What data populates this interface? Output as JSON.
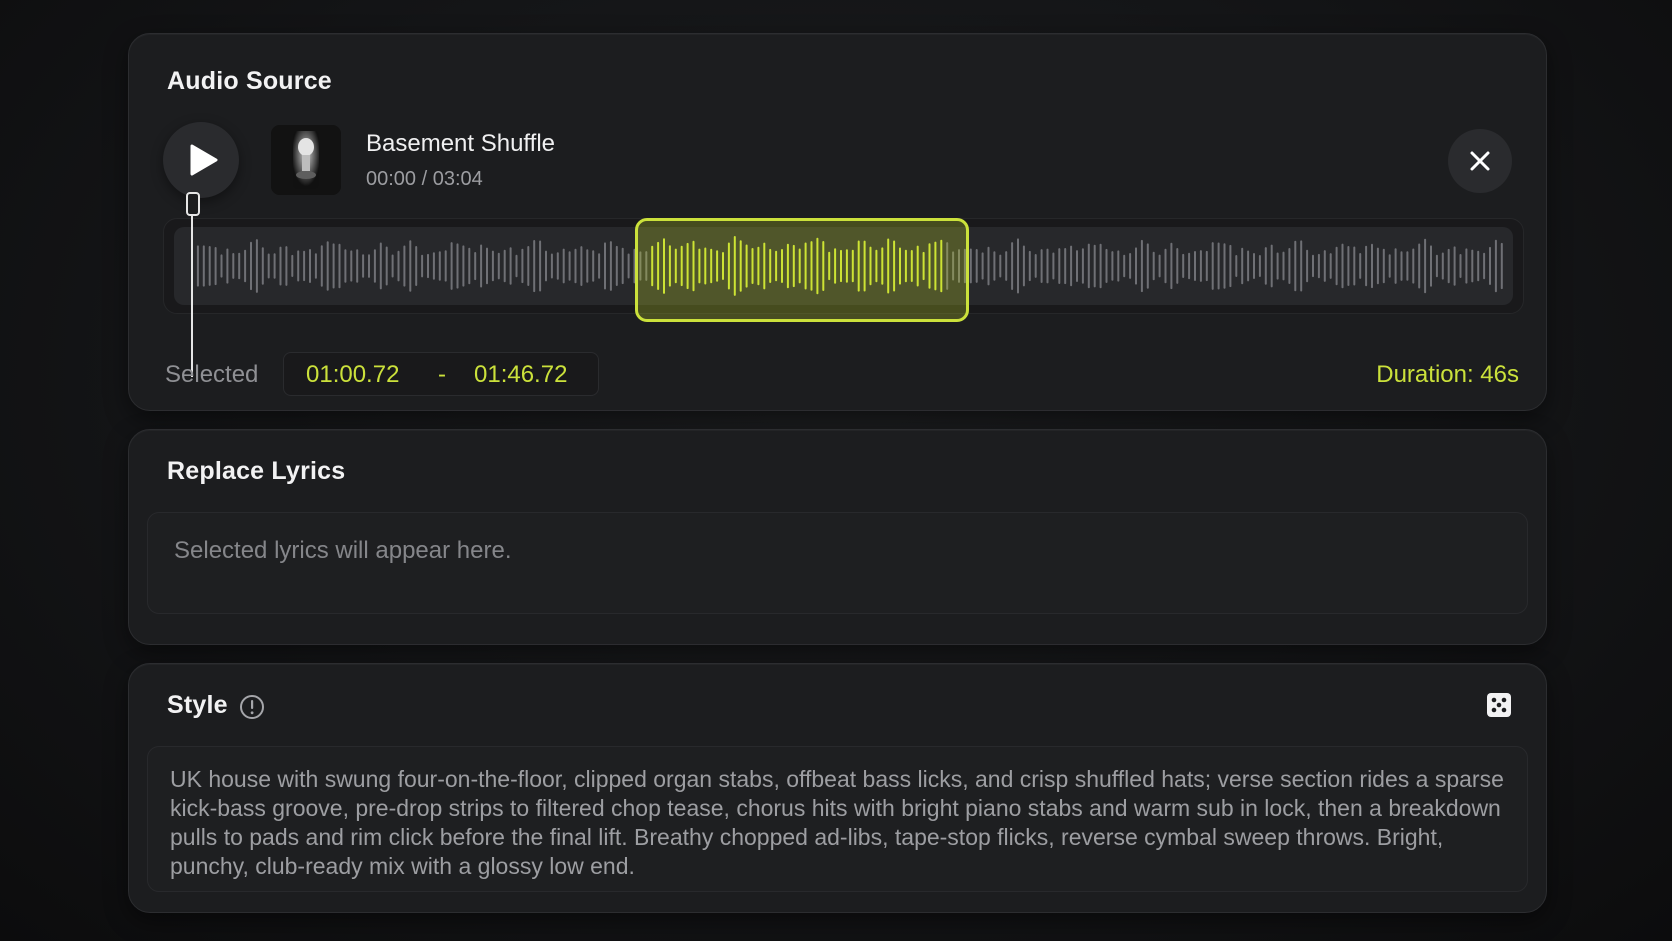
{
  "audio_source": {
    "title": "Audio Source",
    "track": {
      "name": "Basement Shuffle",
      "time": "00:00 / 03:04"
    },
    "playhead_fraction": 0.0,
    "selection": {
      "label": "Selected",
      "start": "01:00.72",
      "separator": "-",
      "end": "01:46.72",
      "duration": "Duration: 46s"
    },
    "icons": {
      "play": "play-icon",
      "close": "close-icon",
      "cover": "album-cover"
    }
  },
  "replace_lyrics": {
    "title": "Replace Lyrics",
    "placeholder": "Selected lyrics will appear here."
  },
  "style": {
    "title": "Style",
    "text": "UK house with swung four-on-the-floor, clipped organ stabs, offbeat bass licks, and crisp shuffled hats; verse section rides a sparse kick-bass groove, pre-drop strips to filtered chop tease, chorus hits with bright piano stabs and warm sub in lock, then a breakdown pulls to pads and rim click before the final lift. Breathy chopped ad-libs, tape-stop flicks, reverse cymbal sweep throws. Bright, punchy, club-ready mix with a glossy low end.",
    "icons": {
      "info": "info-icon",
      "random": "dice-icon"
    }
  },
  "colors": {
    "accent": "#cbe13b",
    "panel": "#1c1d1f",
    "background": "#141517"
  }
}
